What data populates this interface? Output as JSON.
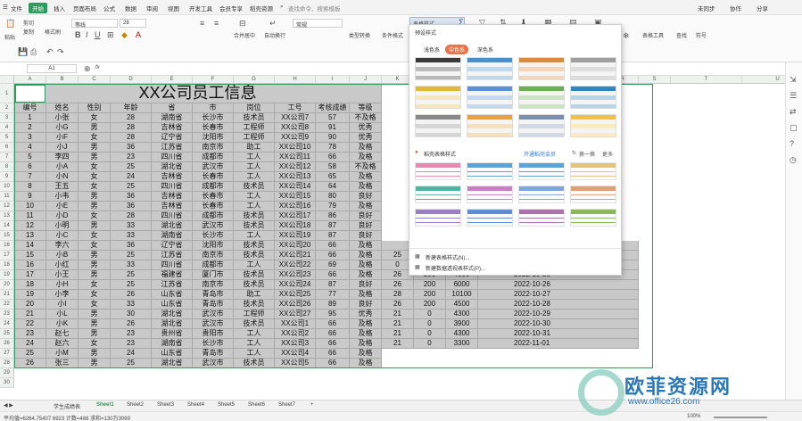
{
  "menubar": {
    "file": "文件",
    "start": "开始",
    "items": [
      "插入",
      "页面布局",
      "公式",
      "数据",
      "审阅",
      "视图",
      "开发工具",
      "会员专享",
      "稻壳资源"
    ],
    "search": "查找命令、搜索模板",
    "sync": "未同步",
    "collab": "协作",
    "share": "分享"
  },
  "toolbar": {
    "paste": "粘贴",
    "cut": "剪切",
    "copy": "复制",
    "format_painter": "格式刷",
    "font_name": "等线",
    "font_size": "28",
    "merge": "合并居中",
    "wrap": "自动换行",
    "number_format": "常规",
    "type_convert": "类型转换",
    "cond_format": "条件格式",
    "table_style": "表格样式",
    "sum": "求和",
    "filter": "筛选",
    "sort": "排序",
    "fill": "填充",
    "cellfmt": "单元格",
    "rowcol": "行和列",
    "worksheet": "工作表",
    "freeze": "冻结窗格",
    "table_tools": "表格工具",
    "find": "查找",
    "symbol": "符号"
  },
  "formulabar": {
    "namebox": "A1",
    "fx": "fx"
  },
  "columns": [
    "A",
    "B",
    "C",
    "D",
    "E",
    "F",
    "G",
    "H",
    "I",
    "J",
    "K",
    "L",
    "M",
    "N",
    "O",
    "P",
    "Q",
    "R",
    "S",
    "T",
    "U",
    "V"
  ],
  "sheet": {
    "title": "XX公司员工信息",
    "headers": [
      "编号",
      "姓名",
      "性别",
      "年龄",
      "省",
      "市",
      "岗位",
      "工号",
      "考核成绩",
      "等级"
    ],
    "rows": [
      [
        "1",
        "小张",
        "女",
        "28",
        "湖南省",
        "长沙市",
        "技术员",
        "XX公司7",
        "57",
        "不及格"
      ],
      [
        "2",
        "小G",
        "男",
        "28",
        "吉林省",
        "长春市",
        "工程师",
        "XX公司8",
        "91",
        "优秀"
      ],
      [
        "3",
        "小F",
        "女",
        "28",
        "辽宁省",
        "沈阳市",
        "工程师",
        "XX公司9",
        "90",
        "优秀"
      ],
      [
        "4",
        "小J",
        "男",
        "36",
        "江苏省",
        "南京市",
        "助工",
        "XX公司10",
        "78",
        "及格"
      ],
      [
        "5",
        "李四",
        "男",
        "23",
        "四川省",
        "成都市",
        "工人",
        "XX公司11",
        "66",
        "及格"
      ],
      [
        "6",
        "小A",
        "女",
        "25",
        "湖北省",
        "武汉市",
        "工人",
        "XX公司12",
        "58",
        "不及格"
      ],
      [
        "7",
        "小N",
        "女",
        "24",
        "吉林省",
        "长春市",
        "工人",
        "XX公司13",
        "65",
        "及格"
      ],
      [
        "8",
        "王五",
        "女",
        "25",
        "四川省",
        "成都市",
        "技术员",
        "XX公司14",
        "64",
        "及格"
      ],
      [
        "9",
        "小韦",
        "男",
        "36",
        "吉林省",
        "长春市",
        "工人",
        "XX公司15",
        "80",
        "良好"
      ],
      [
        "10",
        "小E",
        "男",
        "36",
        "吉林省",
        "长春市",
        "工人",
        "XX公司16",
        "79",
        "及格"
      ],
      [
        "11",
        "小D",
        "女",
        "28",
        "四川省",
        "成都市",
        "技术员",
        "XX公司17",
        "86",
        "良好"
      ],
      [
        "12",
        "小明",
        "男",
        "33",
        "湖北省",
        "武汉市",
        "技术员",
        "XX公司18",
        "87",
        "良好"
      ],
      [
        "13",
        "小C",
        "女",
        "33",
        "湖南省",
        "长沙市",
        "工人",
        "XX公司19",
        "87",
        "良好"
      ],
      [
        "14",
        "李六",
        "女",
        "36",
        "辽宁省",
        "沈阳市",
        "技术员",
        "XX公司20",
        "66",
        "及格"
      ],
      [
        "15",
        "小B",
        "男",
        "25",
        "江苏省",
        "南京市",
        "技术员",
        "XX公司21",
        "66",
        "及格"
      ],
      [
        "16",
        "小红",
        "男",
        "33",
        "四川省",
        "成都市",
        "工人",
        "XX公司22",
        "69",
        "及格"
      ],
      [
        "17",
        "小王",
        "男",
        "25",
        "福建省",
        "厦门市",
        "技术员",
        "XX公司23",
        "66",
        "及格"
      ],
      [
        "18",
        "小H",
        "女",
        "25",
        "江苏省",
        "南京市",
        "技术员",
        "XX公司24",
        "87",
        "良好"
      ],
      [
        "19",
        "小李",
        "女",
        "26",
        "山东省",
        "青岛市",
        "助工",
        "XX公司25",
        "77",
        "及格"
      ],
      [
        "20",
        "小I",
        "女",
        "33",
        "山东省",
        "青岛市",
        "技术员",
        "XX公司26",
        "89",
        "良好"
      ],
      [
        "21",
        "小L",
        "男",
        "30",
        "湖北省",
        "武汉市",
        "工程师",
        "XX公司27",
        "95",
        "优秀"
      ],
      [
        "22",
        "小K",
        "男",
        "26",
        "湖北省",
        "武汉市",
        "技术员",
        "XX公司1",
        "66",
        "及格"
      ],
      [
        "23",
        "赵七",
        "男",
        "23",
        "贵州省",
        "贵阳市",
        "工人",
        "XX公司2",
        "66",
        "及格"
      ],
      [
        "24",
        "赵六",
        "女",
        "23",
        "湖南省",
        "长沙市",
        "工人",
        "XX公司3",
        "66",
        "及格"
      ],
      [
        "25",
        "小M",
        "男",
        "24",
        "山东省",
        "青岛市",
        "工人",
        "XX公司4",
        "66",
        "及格"
      ],
      [
        "26",
        "张三",
        "男",
        "25",
        "湖北省",
        "武汉市",
        "技术员",
        "XX公司5",
        "66",
        "及格"
      ]
    ],
    "extra_rows": [
      {
        "r": 16,
        "o": "",
        "p": "",
        "q": "3400",
        "s": "2022-10-22"
      },
      {
        "r": 17,
        "o": "25",
        "p": "200",
        "q": "4600",
        "s": "2022-10-23"
      },
      {
        "r": 18,
        "o": "0",
        "p": "200",
        "q": "5900",
        "s": "2022-10-24"
      },
      {
        "r": 19,
        "o": "26",
        "p": "200",
        "q": "4600",
        "s": "2022-10-25"
      },
      {
        "r": 20,
        "o": "26",
        "p": "200",
        "q": "6000",
        "s": "2022-10-26"
      },
      {
        "r": 21,
        "o": "28",
        "p": "200",
        "q": "10100",
        "s": "2022-10-27"
      },
      {
        "r": 22,
        "o": "26",
        "p": "200",
        "q": "4500",
        "s": "2022-10-28"
      },
      {
        "r": 23,
        "o": "21",
        "p": "0",
        "q": "4300",
        "s": "2022-10-29"
      },
      {
        "r": 24,
        "o": "21",
        "p": "0",
        "q": "3900",
        "s": "2022-10-30"
      },
      {
        "r": 25,
        "o": "21",
        "p": "0",
        "q": "4300",
        "s": "2022-10-31"
      },
      {
        "r": 26,
        "o": "21",
        "p": "0",
        "q": "3300",
        "s": "2022-11-01"
      }
    ]
  },
  "panel": {
    "header": "预设样式",
    "tabs": [
      "浅色系",
      "中色系",
      "深色系"
    ],
    "rec_label": "稻壳表格样式",
    "vip_link": "开通稻壳会员",
    "switch": "换一换",
    "more": "更多",
    "new_style": "新建表格样式(N)...",
    "new_pivot_style": "新建数据透视表样式(P)...",
    "preset_colors": [
      "#3a3a3a",
      "#4a90c8",
      "#d98a3c",
      "#9e9e9e",
      "#e0b93a",
      "#5b8fd6",
      "#6ab04c",
      "#2e86c1",
      "#888888",
      "#e6a23c",
      "#7b8fb0",
      "#f3c14b"
    ],
    "rec_colors": [
      "#e889b0",
      "#5aa3d6",
      "#5aa3d6",
      "#e3c47a",
      "#4fb3a3",
      "#c880c0",
      "#7fa6d9",
      "#e0a07a",
      "#9a7fc8",
      "#5a8fd6",
      "#b070b0",
      "#88bb55"
    ]
  },
  "sheettabs": [
    "学生成绩表",
    "Sheet1",
    "Sheet2",
    "Sheet3",
    "Sheet4",
    "Sheet5",
    "Sheet6",
    "Sheet7"
  ],
  "status": {
    "summary": "平均值=6264.75407 6923  计数=488  求和=130万3069",
    "zoom": "100%"
  },
  "watermark": {
    "cn": "欧菲资源网",
    "url": "www.office26.com"
  }
}
